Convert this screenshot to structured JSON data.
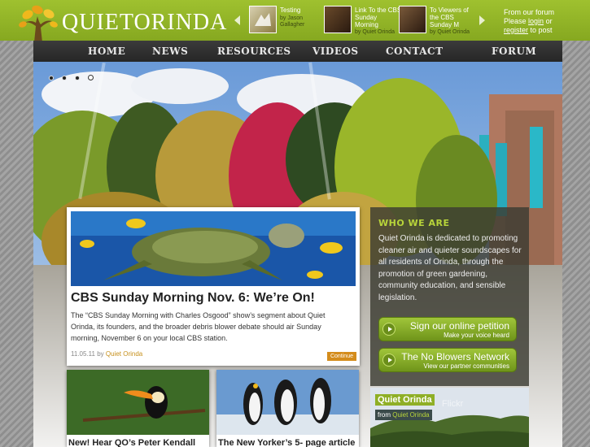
{
  "header": {
    "logo_part1": "QUIET",
    "logo_part2": "ORINDA",
    "featured": [
      {
        "title": "Testing",
        "by_label": "by",
        "author": "Jason Gallagher"
      },
      {
        "title": "Link To the CBS Sunday Morning",
        "by_label": "by",
        "author": "Quiet Orinda"
      },
      {
        "title": "To Viewers of the CBS Sunday M",
        "by_label": "by",
        "author": "Quiet Orinda"
      }
    ],
    "forum_line1": "From our forum",
    "forum_please": "Please",
    "forum_login": "login",
    "forum_or": "or",
    "forum_register": "register",
    "forum_to_post": "to post"
  },
  "nav": {
    "items": [
      "HOME",
      "NEWS",
      "RESOURCES",
      "VIDEOS",
      "CONTACT",
      "FORUM"
    ]
  },
  "slider": {
    "dots": 4,
    "active_index": 3
  },
  "main_post": {
    "title": "CBS Sunday Morning Nov. 6: We’re On!",
    "body": "The “CBS Sunday Morning with Charles Osgood” show’s segment about Quiet Orinda, its founders, and the broader debris blower debate should air Sunday morning, November 6 on your local CBS station.",
    "date": "11.05.11",
    "by_label": "by",
    "author": "Quiet Orinda",
    "continue_label": "Continue"
  },
  "who_we_are": {
    "title": "WHO WE ARE",
    "body": "Quiet Orinda is dedicated to promoting cleaner air and quieter soundscapes for all residents of Orinda, through the promotion of green gardening, community education, and sensible legislation.",
    "buttons": [
      {
        "line1": "Sign our online petition",
        "line2": "Make your voice heard"
      },
      {
        "line1": "The No Blowers Network",
        "line2": "View our partner communities"
      }
    ]
  },
  "widget": {
    "title": "Quiet Orinda",
    "watermark": "Flickr",
    "from_label": "from",
    "from_name": "Quiet Orinda"
  },
  "small_posts": [
    {
      "title": "New! Hear QO’s Peter Kendall"
    },
    {
      "title": "The New Yorker’s 5- page article"
    }
  ],
  "colors": {
    "header_green": "#8fb125",
    "nav_dark": "#2e2e2e",
    "accent_orange": "#d48c1c",
    "who_title_green": "#b8d43a"
  }
}
